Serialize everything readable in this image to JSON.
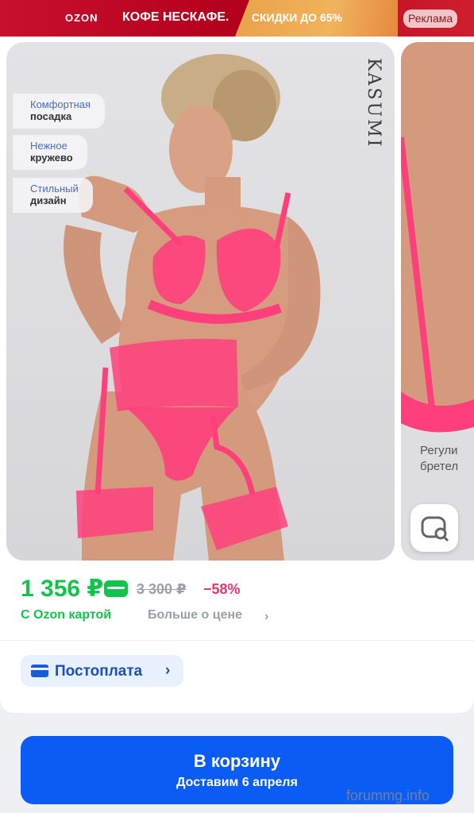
{
  "ad_banner": {
    "brand": "OZON",
    "product": "КОФЕ НЕСКАФЕ.",
    "promo": "СКИДКИ ДО 65%",
    "ad_label": "Реклама"
  },
  "gallery": {
    "brand_logo": "KASUMI",
    "features": [
      {
        "line1": "Комфортная",
        "line2": "посадка"
      },
      {
        "line1": "Нежное",
        "line2": "кружево"
      },
      {
        "line1": "Стильный",
        "line2": "дизайн"
      }
    ],
    "next_image_text": "Регули\nбретел",
    "next_image_text_l1": "Регули",
    "next_image_text_l2": "бретел",
    "visual_search_icon": "camera-search-icon"
  },
  "price": {
    "current": "1 356 ₽",
    "old": "3 300 ₽",
    "discount": "−58%",
    "card_note": "С Ozon картой",
    "more_info": "Больше о цене",
    "more_icon": "chevron-right-icon"
  },
  "payment": {
    "postpay_label": "Постоплата",
    "postpay_icon": "card-icon"
  },
  "cart": {
    "button_label": "В корзину",
    "delivery": "Доставим 6 апреля"
  },
  "watermark": "forummg.info",
  "colors": {
    "accent_green": "#10c44c",
    "discount_pink": "#e8336d",
    "cart_blue": "#0a5cf5",
    "banner_red": "#c8102e"
  }
}
